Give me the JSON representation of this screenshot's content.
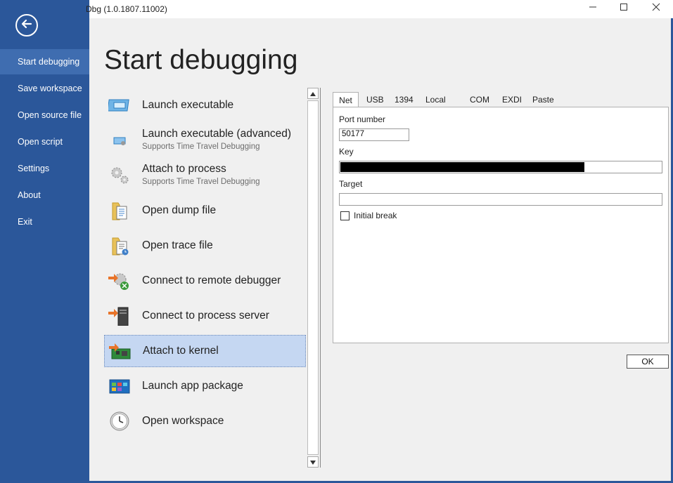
{
  "window": {
    "title": "Dbg (1.0.1807.11002)",
    "controls": {
      "minimize_icon": "minimize-icon",
      "maximize_icon": "maximize-icon",
      "close_icon": "close-icon"
    }
  },
  "sidebar": {
    "back_icon": "back-arrow-icon",
    "items": [
      {
        "label": "Start debugging",
        "active": true
      },
      {
        "label": "Save workspace"
      },
      {
        "label": "Open source file"
      },
      {
        "label": "Open script"
      },
      {
        "label": "Settings"
      },
      {
        "label": "About"
      },
      {
        "label": "Exit"
      }
    ]
  },
  "page_title": "Start debugging",
  "options": [
    {
      "label": "Launch executable",
      "icon": "executable-icon"
    },
    {
      "label": "Launch executable (advanced)",
      "sub": "Supports Time Travel Debugging",
      "icon": "executable-advanced-icon"
    },
    {
      "label": "Attach to process",
      "sub": "Supports Time Travel Debugging",
      "icon": "gears-icon"
    },
    {
      "label": "Open dump file",
      "icon": "dump-file-icon"
    },
    {
      "label": "Open trace file",
      "icon": "trace-file-icon"
    },
    {
      "label": "Connect to remote debugger",
      "icon": "remote-debugger-icon"
    },
    {
      "label": "Connect to process server",
      "icon": "process-server-icon"
    },
    {
      "label": "Attach to kernel",
      "icon": "kernel-icon",
      "selected": true
    },
    {
      "label": "Launch app package",
      "icon": "app-package-icon"
    },
    {
      "label": "Open workspace",
      "icon": "clock-icon"
    }
  ],
  "tabs": [
    "Net",
    "USB",
    "1394",
    "Local",
    "COM",
    "EXDI",
    "Paste"
  ],
  "active_tab": "Net",
  "net_form": {
    "port_label": "Port number",
    "port_value": "50177",
    "key_label": "Key",
    "key_value": "",
    "target_label": "Target",
    "target_value": "",
    "initial_break_label": "Initial break",
    "initial_break_checked": false
  },
  "ok_label": "OK",
  "colors": {
    "sidebar": "#2b579a",
    "selected_item": "#c5d7f2",
    "background": "#f0f0f0"
  }
}
